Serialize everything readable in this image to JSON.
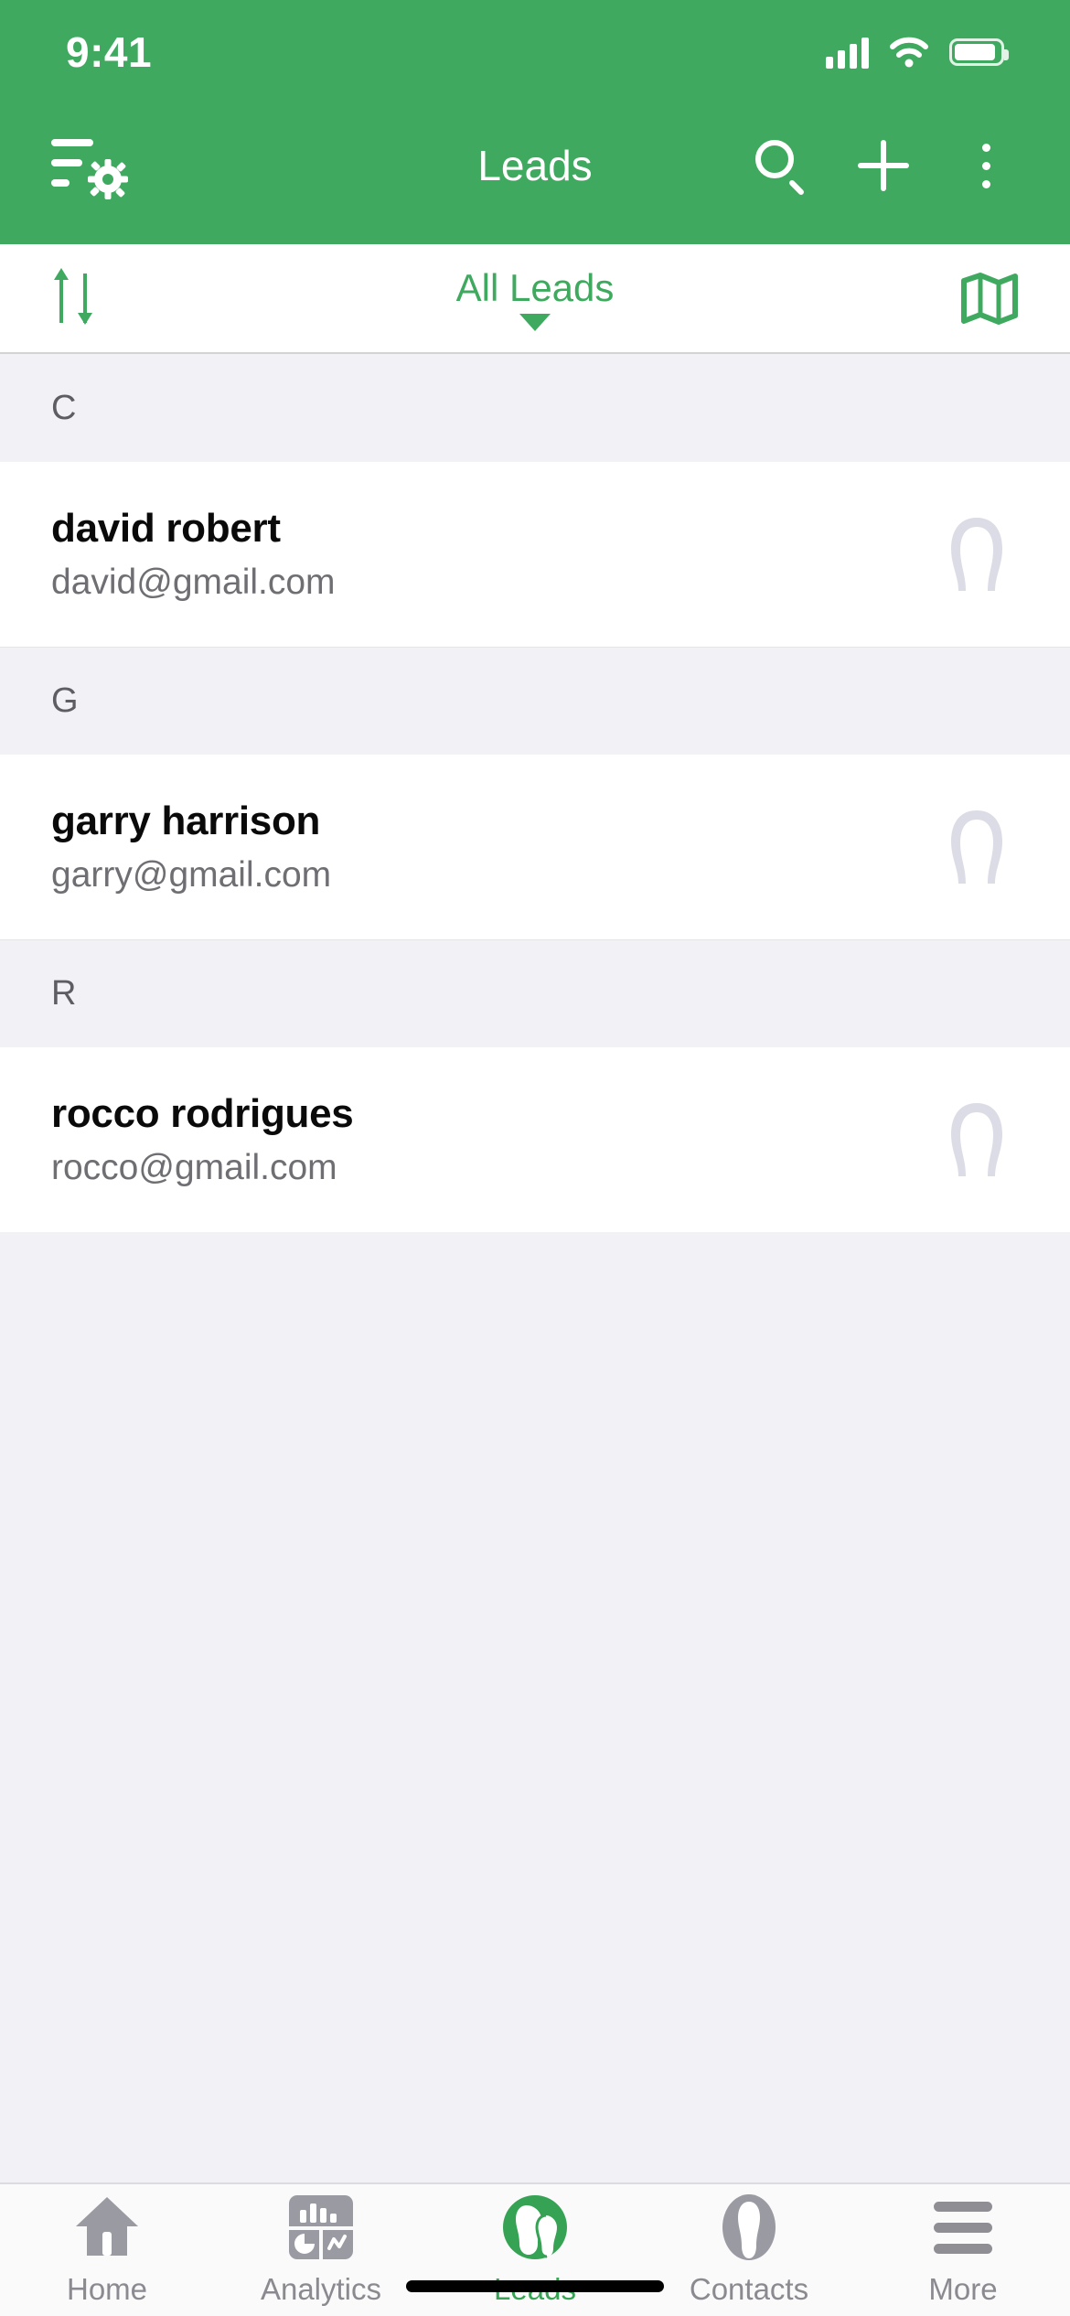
{
  "status_bar": {
    "time": "9:41",
    "signal_icon": "cellular-signal-icon",
    "wifi_icon": "wifi-icon",
    "battery_icon": "battery-icon"
  },
  "header": {
    "title": "Leads",
    "background_color": "#3faa5f",
    "left_action": {
      "name": "filter-settings-icon"
    },
    "actions": [
      {
        "name": "search-icon"
      },
      {
        "name": "add-icon"
      },
      {
        "name": "overflow-menu-icon"
      }
    ]
  },
  "filter_bar": {
    "sort_icon": "sort-icon",
    "view_label": "All Leads",
    "dropdown_icon": "chevron-down-icon",
    "map_icon": "map-icon",
    "accent_color": "#3faa5f"
  },
  "list": {
    "sections": [
      {
        "letter": "C",
        "items": [
          {
            "name": "david robert",
            "email": "david@gmail.com",
            "avatar": "person-placeholder-avatar"
          }
        ]
      },
      {
        "letter": "G",
        "items": [
          {
            "name": "garry harrison",
            "email": "garry@gmail.com",
            "avatar": "person-placeholder-avatar"
          }
        ]
      },
      {
        "letter": "R",
        "items": [
          {
            "name": "rocco rodrigues",
            "email": "rocco@gmail.com",
            "avatar": "person-placeholder-avatar"
          }
        ]
      }
    ]
  },
  "tab_bar": {
    "active": "Leads",
    "tabs": [
      {
        "label": "Home",
        "icon": "home-icon"
      },
      {
        "label": "Analytics",
        "icon": "analytics-icon"
      },
      {
        "label": "Leads",
        "icon": "leads-icon"
      },
      {
        "label": "Contacts",
        "icon": "contacts-icon"
      },
      {
        "label": "More",
        "icon": "menu-icon"
      }
    ]
  }
}
